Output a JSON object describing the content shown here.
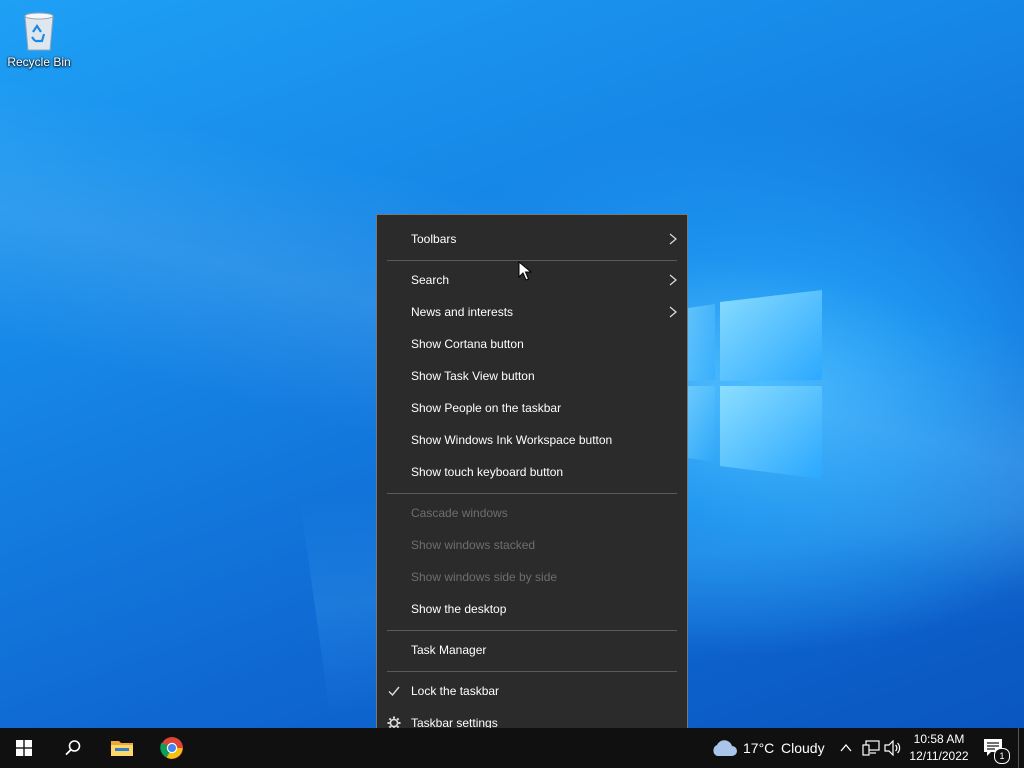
{
  "desktop": {
    "icons": [
      {
        "label": "Recycle Bin",
        "icon": "recycle-bin-icon"
      }
    ]
  },
  "context_menu": {
    "items": [
      {
        "label": "Toolbars",
        "submenu": true,
        "enabled": true
      },
      {
        "label": "Search",
        "submenu": true,
        "enabled": true
      },
      {
        "label": "News and interests",
        "submenu": true,
        "enabled": true
      },
      {
        "label": "Show Cortana button",
        "enabled": true
      },
      {
        "label": "Show Task View button",
        "enabled": true
      },
      {
        "label": "Show People on the taskbar",
        "enabled": true
      },
      {
        "label": "Show Windows Ink Workspace button",
        "enabled": true
      },
      {
        "label": "Show touch keyboard button",
        "enabled": true
      },
      {
        "label": "Cascade windows",
        "enabled": false
      },
      {
        "label": "Show windows stacked",
        "enabled": false
      },
      {
        "label": "Show windows side by side",
        "enabled": false
      },
      {
        "label": "Show the desktop",
        "enabled": true
      },
      {
        "label": "Task Manager",
        "enabled": true
      },
      {
        "label": "Lock the taskbar",
        "enabled": true,
        "checked": true
      },
      {
        "label": "Taskbar settings",
        "enabled": true,
        "icon": "gear-icon"
      }
    ]
  },
  "taskbar": {
    "buttons": [
      "start-icon",
      "search-icon",
      "file-explorer-icon",
      "chrome-icon"
    ],
    "weather": {
      "temp": "17°C",
      "condition": "Cloudy",
      "icon": "cloud-icon"
    },
    "tray_icons": [
      "chevron-up-icon",
      "network-icon",
      "volume-icon"
    ],
    "clock": {
      "time": "10:58 AM",
      "date": "12/11/2022"
    },
    "notifications": {
      "count": "1",
      "icon": "action-center-icon"
    }
  },
  "colors": {
    "menu_bg": "#2b2b2b",
    "taskbar_bg": "#101010",
    "desktop_blue": "#1686e6"
  }
}
